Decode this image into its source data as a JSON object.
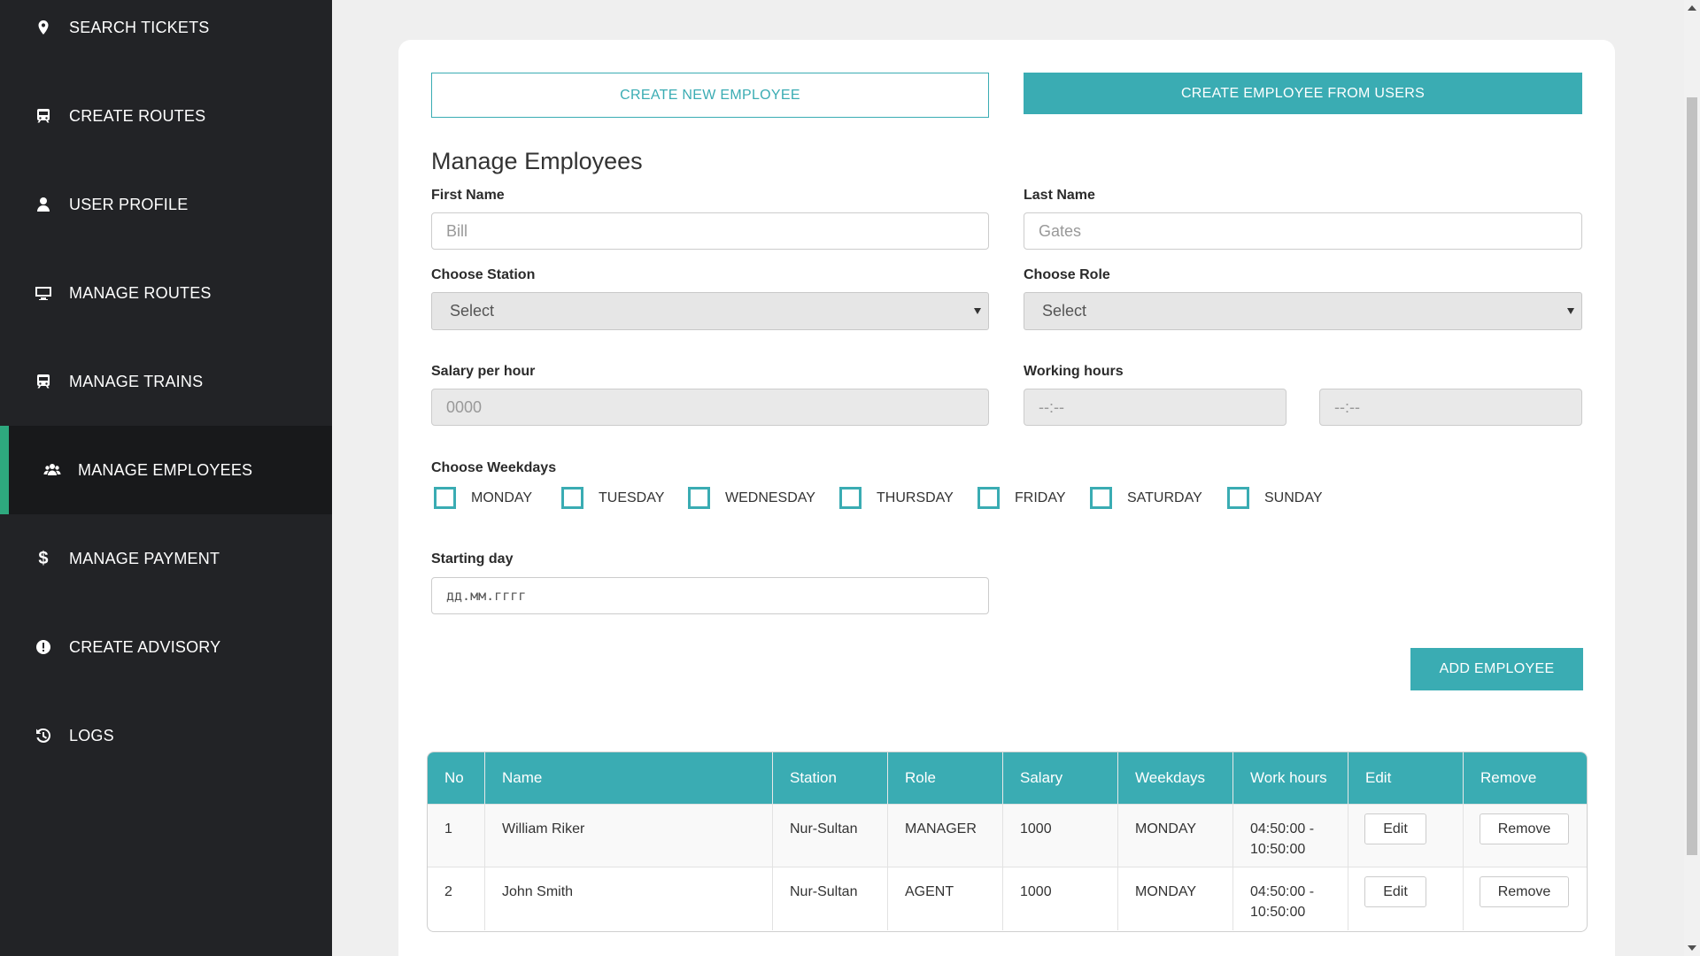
{
  "sidebar": {
    "items": [
      {
        "label": "SEARCH TICKETS",
        "icon": "map-pin-icon"
      },
      {
        "label": "CREATE ROUTES",
        "icon": "train-icon"
      },
      {
        "label": "USER PROFILE",
        "icon": "user-icon"
      },
      {
        "label": "MANAGE ROUTES",
        "icon": "monitor-icon"
      },
      {
        "label": "MANAGE TRAINS",
        "icon": "train-icon"
      },
      {
        "label": "MANAGE EMPLOYEES",
        "icon": "users-icon",
        "active": true
      },
      {
        "label": "MANAGE PAYMENT",
        "icon": "dollar-icon"
      },
      {
        "label": "CREATE ADVISORY",
        "icon": "exclamation-circle-icon"
      },
      {
        "label": "LOGS",
        "icon": "history-icon"
      }
    ],
    "accent_color": "#2ea87e"
  },
  "actions": {
    "create_new": "CREATE NEW EMPLOYEE",
    "create_from_users": "CREATE EMPLOYEE FROM USERS"
  },
  "form": {
    "title": "Manage Employees",
    "first_name_label": "First Name",
    "first_name_placeholder": "Bill",
    "last_name_label": "Last Name",
    "last_name_placeholder": "Gates",
    "station_label": "Choose Station",
    "station_value": "Select",
    "role_label": "Choose Role",
    "role_value": "Select",
    "salary_label": "Salary per hour",
    "salary_placeholder": "0000",
    "hours_label": "Working hours",
    "hours_from": "--:--",
    "hours_to": "--:--",
    "weekdays_label": "Choose Weekdays",
    "weekdays": [
      "MONDAY",
      "TUESDAY",
      "WEDNESDAY",
      "THURSDAY",
      "FRIDAY",
      "SATURDAY",
      "SUNDAY"
    ],
    "start_label": "Starting day",
    "start_placeholder": "дд.мм.гггг",
    "add_button": "ADD EMPLOYEE"
  },
  "table": {
    "headers": [
      "No",
      "Name",
      "Station",
      "Role",
      "Salary",
      "Weekdays",
      "Work hours",
      "Edit",
      "Remove"
    ],
    "rows": [
      {
        "no": "1",
        "name": "William Riker",
        "station": "Nur-Sultan",
        "role": "MANAGER",
        "salary": "1000",
        "weekdays": "MONDAY",
        "hours": "04:50:00 -",
        "hours2": "10:50:00",
        "edit": "Edit",
        "remove": "Remove"
      },
      {
        "no": "2",
        "name": "John Smith",
        "station": "Nur-Sultan",
        "role": "AGENT",
        "salary": "1000",
        "weekdays": "MONDAY",
        "hours": "04:50:00 -",
        "hours2": "10:50:00",
        "edit": "Edit",
        "remove": "Remove"
      }
    ]
  },
  "colors": {
    "primary": "#3aacb3",
    "sidebar_bg": "#222326"
  }
}
